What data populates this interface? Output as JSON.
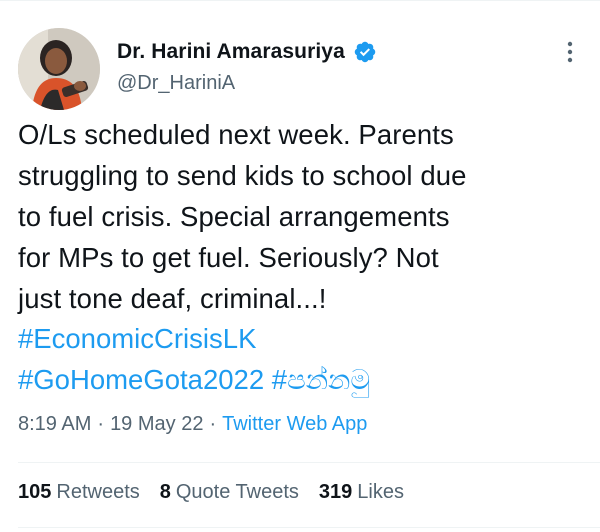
{
  "tweet": {
    "author": {
      "display_name": "Dr. Harini Amarasuriya",
      "handle": "@Dr_HariniA",
      "avatar_icon": "profile-photo",
      "verified_icon": "verified-badge-icon",
      "verified_color": "#1d9bf0"
    },
    "text": "O/Ls scheduled next week. Parents\nstruggling to send kids to school due\nto fuel crisis. Special arrangements\nfor MPs to get fuel. Seriously?  Not\njust tone deaf, criminal...!",
    "hashtags": [
      "#EconomicCrisisLK",
      "#GoHomeGota2022",
      "#පන්නමු"
    ],
    "time": "8:19 AM",
    "separator": "·",
    "date": "19 May 22",
    "source": "Twitter Web App",
    "stats": {
      "retweets": {
        "count": "105",
        "label": "Retweets"
      },
      "quotes": {
        "count": "8",
        "label": "Quote Tweets"
      },
      "likes": {
        "count": "319",
        "label": "Likes"
      }
    }
  },
  "colors": {
    "link": "#1d9bf0",
    "secondary_text": "#536471",
    "primary_text": "#0f1419",
    "divider": "#eff3f4"
  }
}
